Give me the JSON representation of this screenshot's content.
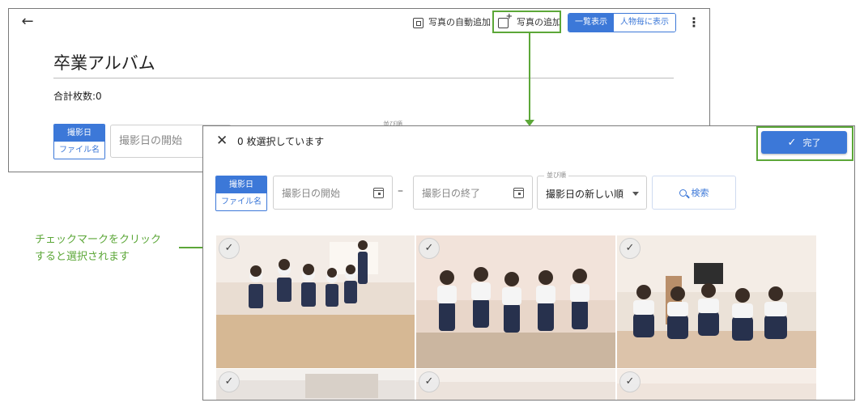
{
  "background_page": {
    "toolbar": {
      "auto_add_label": "写真の自動追加",
      "add_photo_label": "写真の追加",
      "view_list_label": "一覧表示",
      "view_person_label": "人物毎に表示"
    },
    "album_title": "卒業アルバム",
    "total_count": "合計枚数:0",
    "sort_toggle": {
      "date": "撮影日",
      "filename": "ファイル名"
    },
    "date_start_placeholder": "撮影日の開始",
    "sort_label": "並び順"
  },
  "callout": {
    "line1": "チェックマークをクリック",
    "line2": "すると選択されます"
  },
  "dialog": {
    "selected_text": "0 枚選択しています",
    "done_label": "完了",
    "filter_toggle": {
      "date": "撮影日",
      "filename": "ファイル名"
    },
    "date_start_placeholder": "撮影日の開始",
    "date_end_placeholder": "撮影日の終了",
    "dash": "–",
    "sort": {
      "label": "並び順",
      "value": "撮影日の新しい順"
    },
    "search_label": "検索",
    "photos": [
      {
        "checked": false
      },
      {
        "checked": false
      },
      {
        "checked": false
      },
      {
        "checked": false
      },
      {
        "checked": false
      },
      {
        "checked": false
      }
    ]
  },
  "colors": {
    "accent": "#3c78d8",
    "highlight_green": "#5ca738"
  },
  "icons": {
    "back": "arrow-left-icon",
    "auto_add": "gallery-icon",
    "add_photo": "add-photo-icon",
    "more": "more-vert-icon",
    "close": "close-icon",
    "done": "check-icon",
    "calendar": "calendar-icon",
    "search": "search-icon",
    "photo_check": "check-circle-icon"
  }
}
